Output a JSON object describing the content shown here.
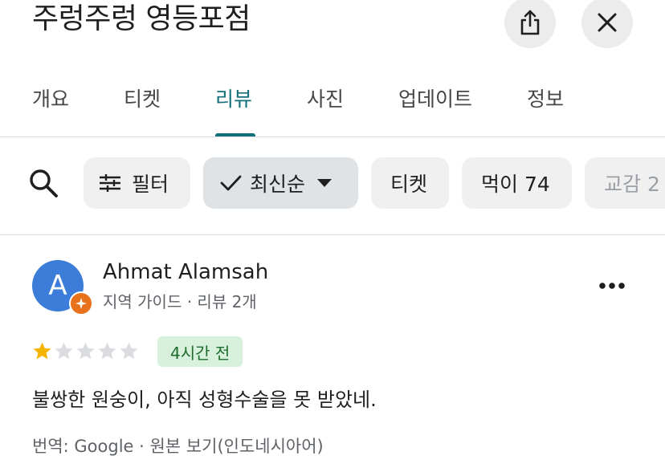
{
  "header": {
    "title": "주렁주렁 영등포점",
    "share_icon": "share-icon",
    "close_icon": "close-icon"
  },
  "tabs": [
    {
      "label": "개요"
    },
    {
      "label": "티켓"
    },
    {
      "label": "리뷰",
      "active": true
    },
    {
      "label": "사진"
    },
    {
      "label": "업데이트"
    },
    {
      "label": "정보"
    }
  ],
  "filters": {
    "search_icon": "search-icon",
    "chips": [
      {
        "label": "필터",
        "icon": "tune-icon"
      },
      {
        "label": "최신순",
        "icon": "check-icon",
        "selected": true
      },
      {
        "label": "티켓"
      },
      {
        "label": "먹이 74"
      },
      {
        "label": "교감 2"
      }
    ]
  },
  "review": {
    "avatar_letter": "A",
    "name": "Ahmat Alamsah",
    "meta": "지역 가이드 · 리뷰 2개",
    "rating": 1,
    "max_rating": 5,
    "time": "4시간 전",
    "text": "불쌍한 원숭이, 아직 성형수술을 못 받았네.",
    "translation_source": "번역: Google",
    "separator": " · ",
    "view_original": "원본 보기(인도네시아어)"
  },
  "colors": {
    "accent": "#13707a",
    "avatar": "#3b7dd8",
    "badge": "#e8711c",
    "star_filled": "#f4b400",
    "star_empty": "#dadce0",
    "time_badge_bg": "#d8f1dc"
  }
}
